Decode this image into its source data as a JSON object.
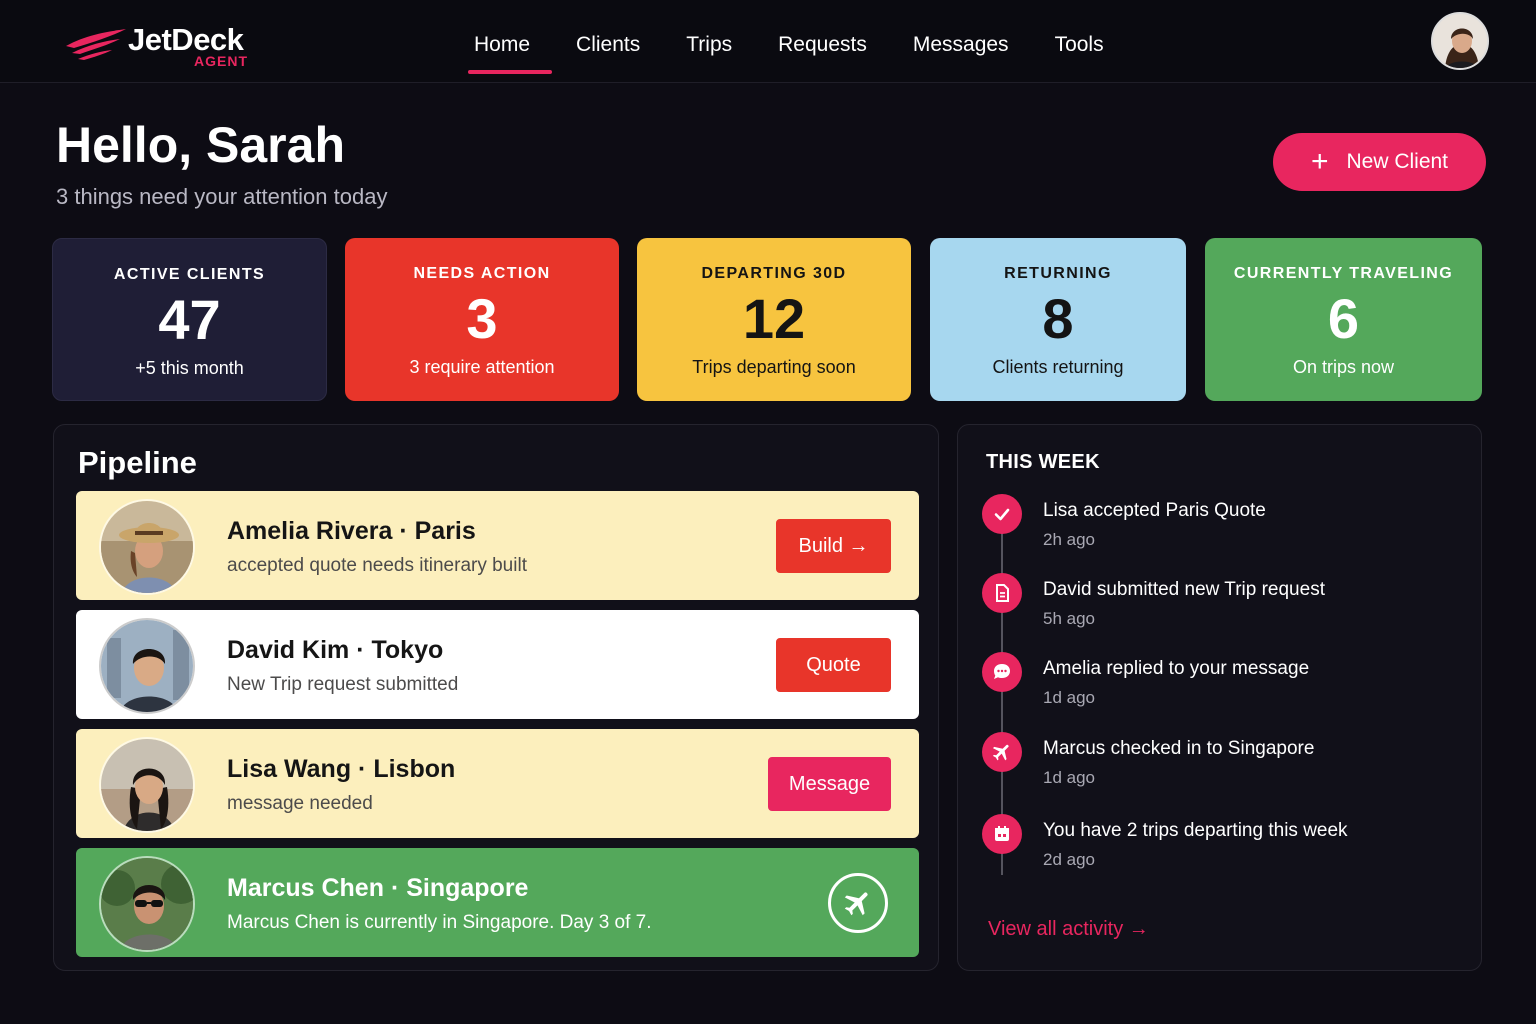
{
  "brand": {
    "name": "JetDeck",
    "sub": "AGENT",
    "accent": "#e8265f"
  },
  "nav": {
    "items": [
      {
        "label": "Home"
      },
      {
        "label": "Clients"
      },
      {
        "label": "Trips"
      },
      {
        "label": "Requests"
      },
      {
        "label": "Messages"
      },
      {
        "label": "Tools"
      }
    ]
  },
  "greeting": {
    "title": "Hello, Sarah",
    "subtitle": "3 things need your attention today"
  },
  "actions": {
    "new_client": "New Client"
  },
  "stats": [
    {
      "label": "ACTIVE CLIENTS",
      "value": "47",
      "note": "+5 this month",
      "color": "#1f1e36"
    },
    {
      "label": "NEEDS ACTION",
      "value": "3",
      "note": "3 require attention",
      "color": "#e8352a"
    },
    {
      "label": "DEPARTING 30D",
      "value": "12",
      "note": "Trips departing soon",
      "color": "#f7c43f"
    },
    {
      "label": "RETURNING",
      "value": "8",
      "note": "Clients returning",
      "color": "#a7d7ef"
    },
    {
      "label": "CURRENTLY TRAVELING",
      "value": "6",
      "note": "On trips now",
      "color": "#54a85b"
    }
  ],
  "pipeline": {
    "title": "Pipeline",
    "rows": [
      {
        "name": "Amelia Rivera",
        "dest": "Paris",
        "sub": "accepted quote needs itinerary built",
        "action": "Build →",
        "bg": "#fcefbd"
      },
      {
        "name": "David Kim",
        "dest": "Tokyo",
        "sub": "New Trip request submitted",
        "action": "Quote",
        "bg": "#ffffff"
      },
      {
        "name": "Lisa Wang",
        "dest": "Lisbon",
        "sub": "message needed",
        "action": "Message",
        "bg": "#fcefbd"
      },
      {
        "name": "Marcus Chen",
        "dest": "Singapore",
        "sub": "Marcus Chen is currently in Singapore. Day 3 of 7.",
        "action_icon": "airplane-icon",
        "bg": "#54a85b"
      }
    ],
    "separator": "·"
  },
  "this_week": {
    "title": "THIS WEEK",
    "items": [
      {
        "text": "Lisa accepted Paris Quote",
        "time": "2h ago",
        "icon": "check-icon"
      },
      {
        "text": "David submitted new Trip request",
        "time": "5h ago",
        "icon": "document-icon"
      },
      {
        "text": "Amelia replied to your message",
        "time": "1d ago",
        "icon": "chat-icon"
      },
      {
        "text": "Marcus checked in to Singapore",
        "time": "1d ago",
        "icon": "airplane-icon"
      },
      {
        "text": "You have 2 trips departing this week",
        "time": "2d ago",
        "icon": "calendar-icon"
      }
    ],
    "view_all": "View all activity →"
  }
}
